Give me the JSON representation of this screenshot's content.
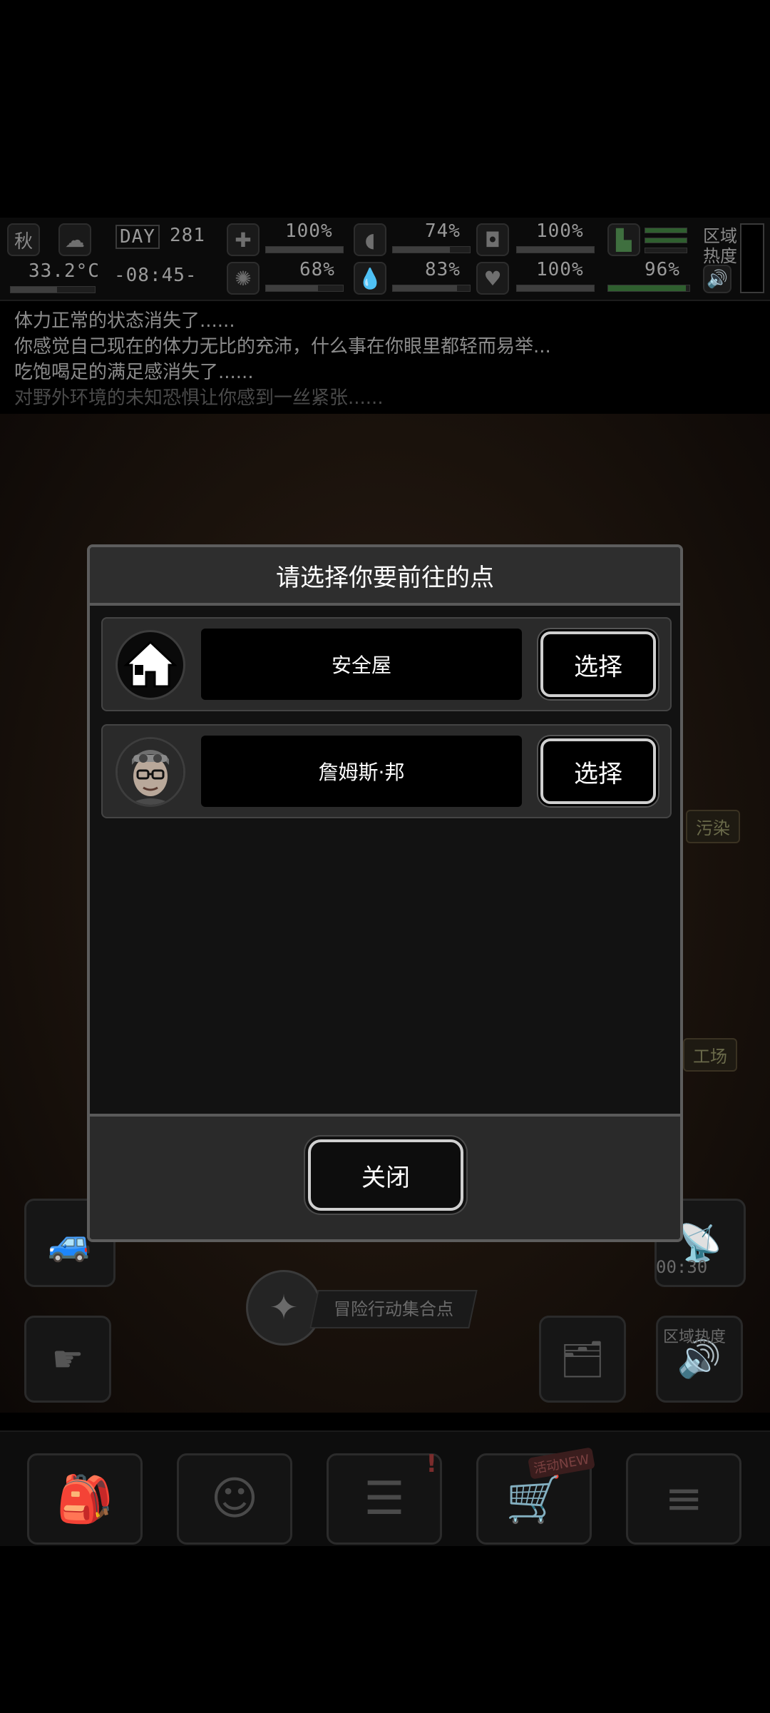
{
  "hud": {
    "season": "秋",
    "temperature": "33.2°C",
    "day_label": "DAY",
    "day_number": "281",
    "clock": "-08:45-",
    "stats": [
      {
        "icon": "medkit-icon",
        "value": "100%"
      },
      {
        "icon": "stomach-icon",
        "value": "74%"
      },
      {
        "icon": "armor-icon",
        "value": "100%"
      },
      {
        "icon": "brain-icon",
        "value": "68%"
      },
      {
        "icon": "water-drop-icon",
        "value": "83%"
      },
      {
        "icon": "heart-icon",
        "value": "100%"
      },
      {
        "icon": "boot-icon",
        "value": ""
      },
      {
        "icon": "stamina-icon",
        "value": "96%"
      }
    ],
    "zone_heat_label": "区域热度"
  },
  "messages": [
    "体力正常的状态消失了......",
    "你感觉自己现在的体力无比的充沛，什么事在你眼里都轻而易举...",
    "吃饱喝足的满足感消失了......",
    "对野外环境的未知恐惧让你感到一丝紧张......"
  ],
  "map": {
    "side_chip_1": "污染",
    "side_chip_2": "工场",
    "rally_point": "冒险行动集合点",
    "timer": "00:30",
    "zone_heat": "区域热度"
  },
  "nav": {
    "items": [
      "backpack-icon",
      "brain-profile-icon",
      "notebook-icon",
      "shopping-cart-icon",
      "menu-list-icon"
    ],
    "cart_badge": "活动NEW"
  },
  "dialog": {
    "title": "请选择你要前往的点",
    "options": [
      {
        "name": "安全屋",
        "select_label": "选择",
        "icon": "house-icon"
      },
      {
        "name": "詹姆斯·邦",
        "select_label": "选择",
        "icon": "character-avatar-icon"
      }
    ],
    "close_label": "关闭"
  }
}
